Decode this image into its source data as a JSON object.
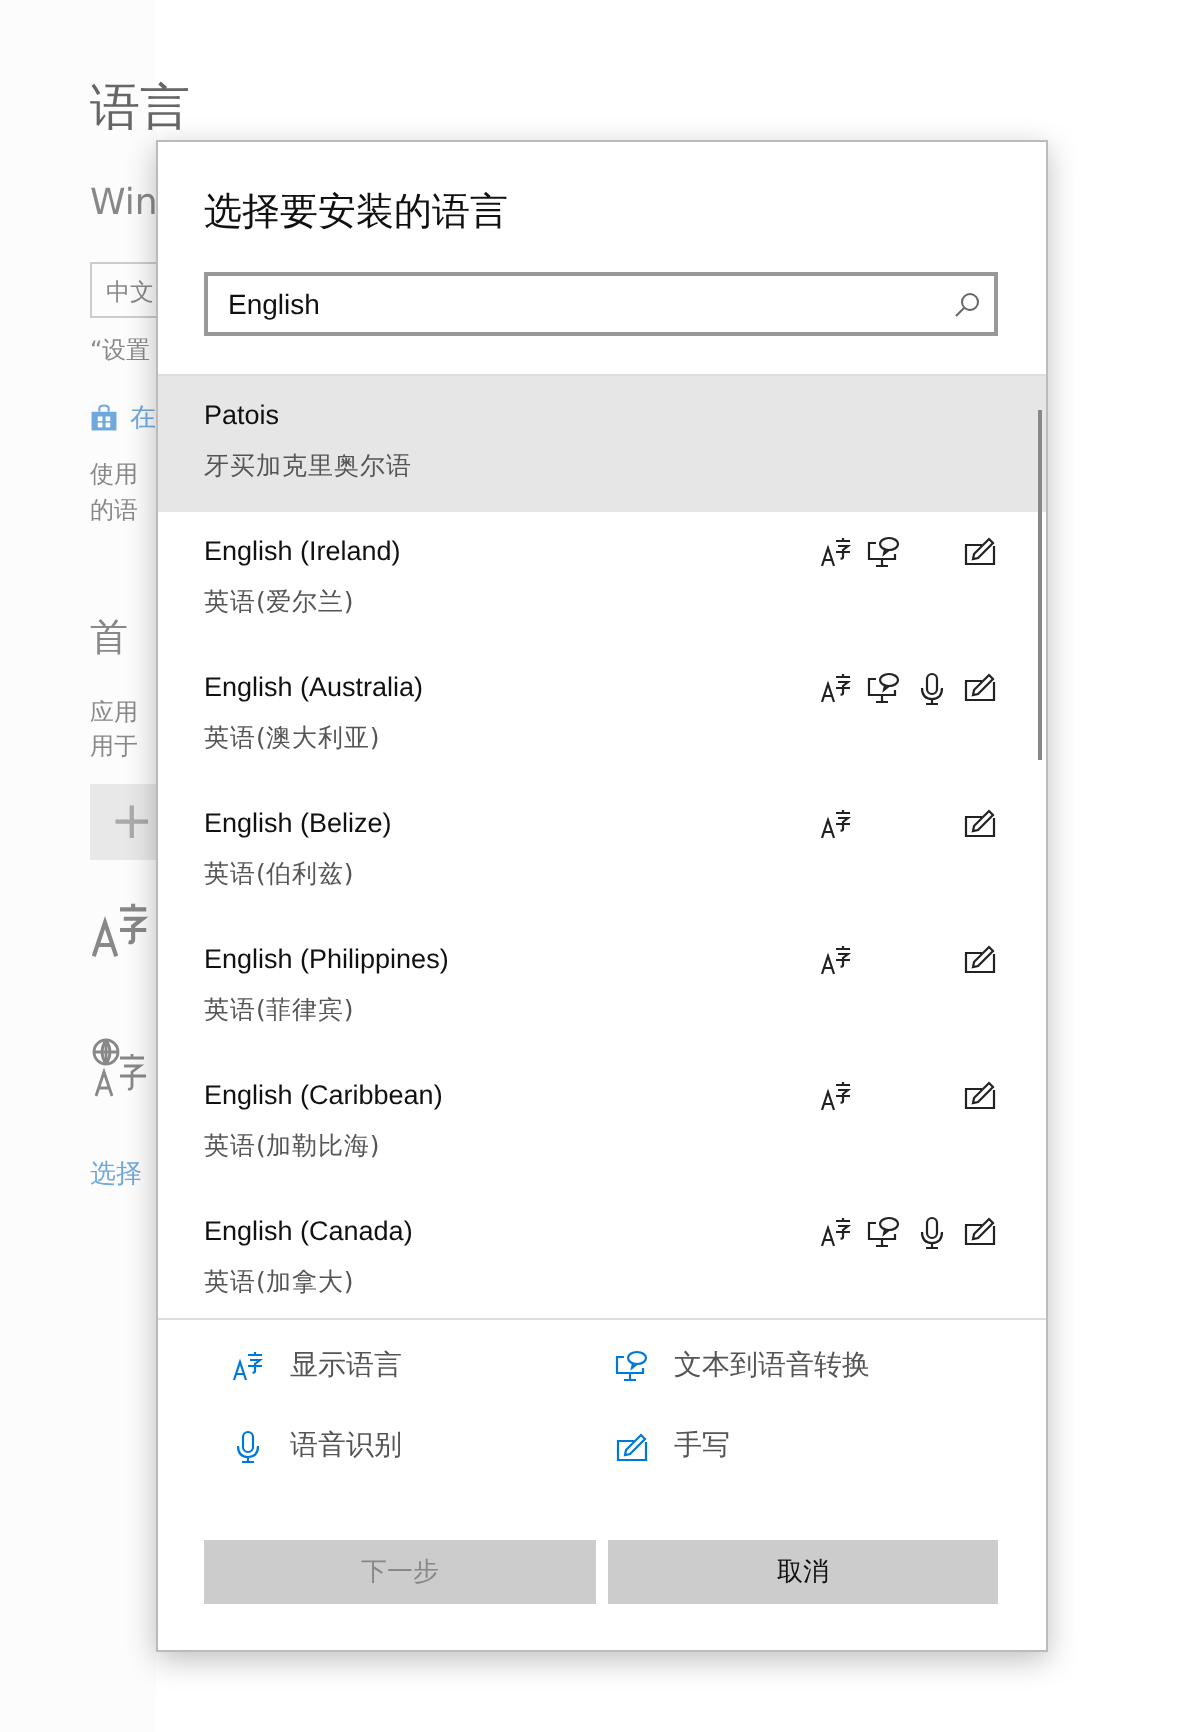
{
  "background": {
    "title": "语言",
    "subtitle": "Win",
    "language_field": "中文",
    "note": "“设置",
    "store_link": "在",
    "paragraph": [
      "使用",
      "的语"
    ],
    "section_title": "首",
    "section_text": [
      "应用",
      "用于"
    ],
    "add_button": "+",
    "bottom_link": "选择"
  },
  "dialog": {
    "title": "选择要安装的语言",
    "search": {
      "value": "English"
    },
    "languages": [
      {
        "name": "Patois",
        "native": "牙买加克里奥尔语",
        "selected": true,
        "display": false,
        "tts": false,
        "speech": false,
        "handwriting": false
      },
      {
        "name": "English (Ireland)",
        "native": "英语(爱尔兰)",
        "selected": false,
        "display": true,
        "tts": true,
        "speech": false,
        "handwriting": true
      },
      {
        "name": "English (Australia)",
        "native": "英语(澳大利亚)",
        "selected": false,
        "display": true,
        "tts": true,
        "speech": true,
        "handwriting": true
      },
      {
        "name": "English (Belize)",
        "native": "英语(伯利兹)",
        "selected": false,
        "display": true,
        "tts": false,
        "speech": false,
        "handwriting": true
      },
      {
        "name": "English (Philippines)",
        "native": "英语(菲律宾)",
        "selected": false,
        "display": true,
        "tts": false,
        "speech": false,
        "handwriting": true
      },
      {
        "name": "English (Caribbean)",
        "native": "英语(加勒比海)",
        "selected": false,
        "display": true,
        "tts": false,
        "speech": false,
        "handwriting": true
      },
      {
        "name": "English (Canada)",
        "native": "英语(加拿大)",
        "selected": false,
        "display": true,
        "tts": true,
        "speech": true,
        "handwriting": true
      }
    ],
    "legend": [
      {
        "kind": "display",
        "label": "显示语言"
      },
      {
        "kind": "tts",
        "label": "文本到语音转换"
      },
      {
        "kind": "speech",
        "label": "语音识别"
      },
      {
        "kind": "handwriting",
        "label": "手写"
      }
    ],
    "buttons": [
      {
        "label": "下一步",
        "disabled": true
      },
      {
        "label": "取消",
        "disabled": false
      }
    ]
  }
}
